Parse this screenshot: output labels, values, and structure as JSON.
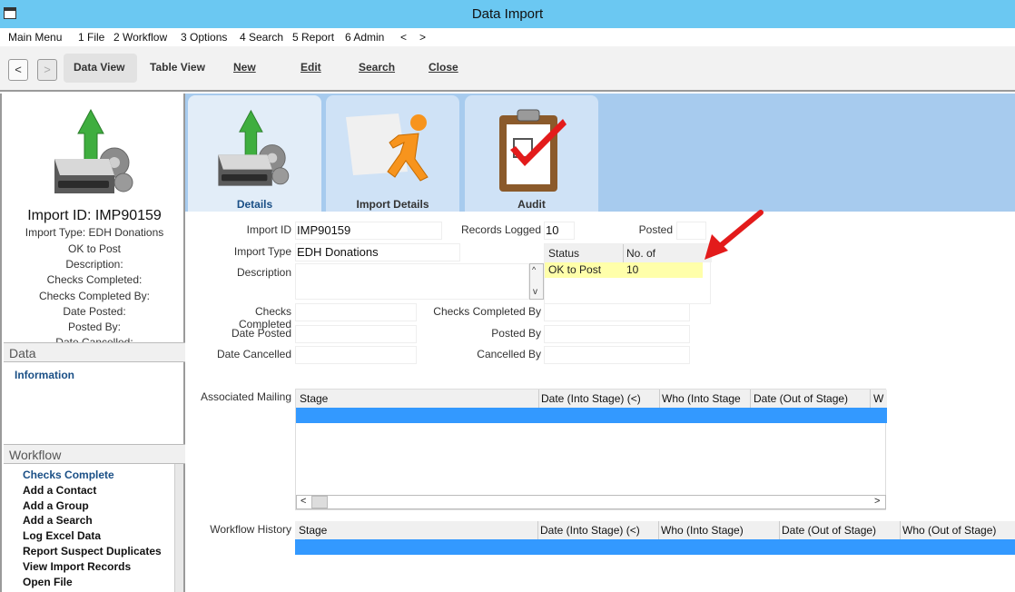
{
  "window": {
    "title": "Data Import"
  },
  "menu": [
    {
      "label": "Main Menu"
    },
    {
      "label": "1 File"
    },
    {
      "label": "2 Workflow"
    },
    {
      "label": "3 Options"
    },
    {
      "label": "4 Search"
    },
    {
      "label": "5 Report"
    },
    {
      "label": "6 Admin"
    },
    {
      "label": "<"
    },
    {
      "label": ">"
    }
  ],
  "toolbar": {
    "back": "<",
    "forward": ">",
    "data_view": "Data View",
    "table_view": "Table View",
    "new": "New",
    "edit": "Edit",
    "search": "Search",
    "close": "Close"
  },
  "summary": {
    "title": "Import ID: IMP90159",
    "lines": [
      "Import Type: EDH Donations",
      "OK to Post",
      "Description:",
      "Checks Completed:",
      "Checks Completed By:",
      "Date Posted:",
      "Posted By:",
      "Date Cancelled:"
    ]
  },
  "data_section": {
    "header": "Data",
    "items": [
      "Information"
    ]
  },
  "workflow_section": {
    "header": "Workflow",
    "items": [
      "Checks Complete",
      "Add a Contact",
      "Add a Group",
      "Add a Search",
      "Log Excel Data",
      "Report Suspect Duplicates",
      "View Import Records",
      "Open File"
    ]
  },
  "tabs": [
    {
      "label": "Details"
    },
    {
      "label": "Import Details"
    },
    {
      "label": "Audit"
    }
  ],
  "form": {
    "import_id_label": "Import ID",
    "import_id": "IMP90159",
    "records_logged_label": "Records Logged",
    "records_logged": "10",
    "posted_label": "Posted",
    "posted": "",
    "import_type_label": "Import Type",
    "import_type": "EDH Donations",
    "description_label": "Description",
    "description": "",
    "checks_completed_label": "Checks Completed",
    "checks_completed": "",
    "checks_completed_by_label": "Checks Completed By",
    "checks_completed_by": "",
    "date_posted_label": "Date Posted",
    "date_posted": "",
    "posted_by_label": "Posted By",
    "posted_by": "",
    "date_cancelled_label": "Date Cancelled",
    "date_cancelled": "",
    "cancelled_by_label": "Cancelled By",
    "cancelled_by": ""
  },
  "status_table": {
    "headers": [
      "Status",
      "No. of"
    ],
    "rows": [
      {
        "status": "OK to Post",
        "count": "10"
      }
    ]
  },
  "associated_mailing": {
    "label": "Associated Mailing",
    "headers": [
      "Stage",
      "Date (Into Stage) (<)",
      "Who (Into Stage",
      "Date (Out of Stage)",
      "W"
    ]
  },
  "workflow_history": {
    "label": "Workflow History",
    "headers": [
      "Stage",
      "Date (Into Stage) (<)",
      "Who (Into Stage)",
      "Date (Out of Stage)",
      "Who (Out of Stage)"
    ]
  },
  "scroll": {
    "left": "<",
    "right": ">",
    "up": "^",
    "down": "v"
  },
  "colors": {
    "titlebar": "#6bc8f2",
    "tabstrip": "#a7cbee",
    "selection": "#3399ff",
    "highlight_row": "#ffffaa",
    "annotation_arrow": "#e31b1b"
  }
}
